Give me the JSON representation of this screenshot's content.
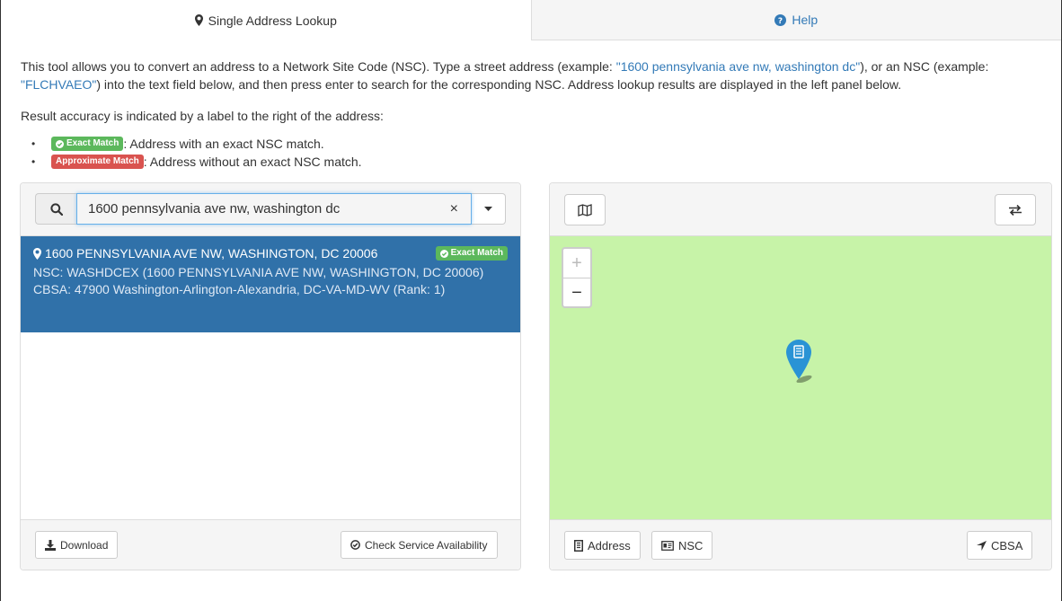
{
  "tabs": [
    {
      "label": "Single Address Lookup",
      "icon": "map-marker-icon",
      "active": true
    },
    {
      "label": "Help",
      "icon": "question-circle-icon",
      "active": false
    }
  ],
  "intro": {
    "part1": "This tool allows you to convert an address to a Network Site Code (NSC). Type a street address (example: ",
    "example_address": "\"1600 pennsylvania ave nw, washington dc\"",
    "part2": "), or an NSC (example: ",
    "example_nsc": "\"FLCHVAEO\"",
    "part3": ") into the text field below, and then press enter to search for the corresponding NSC. Address lookup results are displayed in the left panel below."
  },
  "accuracy_text": "Result accuracy is indicated by a label to the right of the address:",
  "legend": [
    {
      "badge": "Exact Match",
      "text": ": Address with an exact NSC match.",
      "color": "#5cb85c"
    },
    {
      "badge": "Approximate Match",
      "text": ": Address without an exact NSC match.",
      "color": "#d9534f"
    }
  ],
  "search": {
    "value": "1600 pennsylvania ave nw, washington dc",
    "clear": "×"
  },
  "result": {
    "title": "1600 PENNSYLVANIA AVE NW, WASHINGTON, DC 20006",
    "badge": "Exact Match",
    "nsc": "NSC: WASHDCEX (1600 PENNSYLVANIA AVE NW, WASHINGTON, DC 20006)",
    "cbsa": "CBSA: 47900 Washington-Arlington-Alexandria, DC-VA-MD-WV (Rank: 1)"
  },
  "left_footer": {
    "download": "Download",
    "check": "Check Service Availability"
  },
  "map": {
    "zoom_in": "+",
    "zoom_out": "−",
    "background": "#c7f3a8"
  },
  "right_footer": {
    "address": "Address",
    "nsc": "NSC",
    "cbsa": "CBSA"
  },
  "colors": {
    "accent": "#337ab7",
    "selected": "#3071a9"
  }
}
